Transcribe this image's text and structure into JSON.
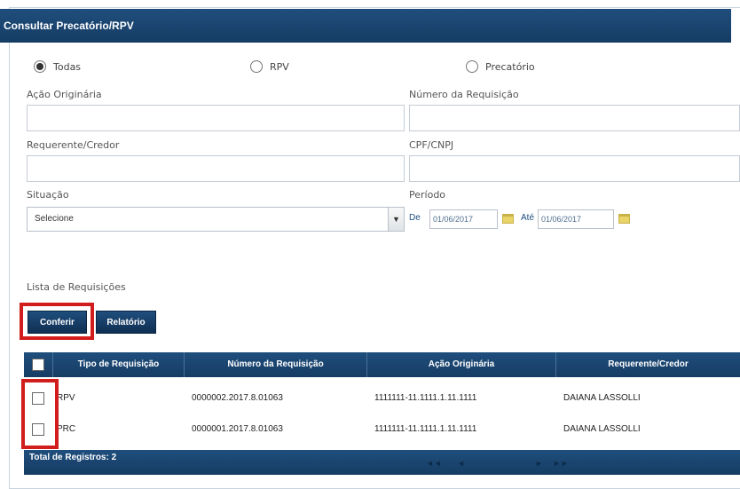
{
  "window": {
    "title": "Consultar Precatório/RPV"
  },
  "filters": {
    "radio_options": [
      {
        "label": "Todas",
        "checked": true
      },
      {
        "label": "RPV",
        "checked": false
      },
      {
        "label": "Precatório",
        "checked": false
      }
    ],
    "acao_originaria_label": "Ação Originária",
    "numero_requisicao_label": "Número da Requisição",
    "requerente_label": "Requerente/Credor",
    "cpf_cnpj_label": "CPF/CNPJ",
    "situacao_label": "Situação",
    "situacao_value": "Selecione",
    "periodo_label": "Período",
    "de_label": "De",
    "de_value": "01/06/2017",
    "ate_label": "Até",
    "ate_value": "01/06/2017"
  },
  "list": {
    "title": "Lista de Requisições",
    "conferir_label": "Conferir",
    "relatorio_label": "Relatório",
    "columns": [
      "Tipo de Requisição",
      "Número da Requisição",
      "Ação Originária",
      "Requerente/Credor"
    ],
    "rows": [
      {
        "tipo": "RPV",
        "numero": "0000002.2017.8.01063",
        "acao": "1111111-11.1111.1.11.1111",
        "requerente": "DAIANA LASSOLLI"
      },
      {
        "tipo": "PRC",
        "numero": "0000001.2017.8.01063",
        "acao": "1111111-11.1111.1.11.1111",
        "requerente": "DAIANA LASSOLLI"
      }
    ],
    "total_label": "Total de Registros: 2",
    "pager": {
      "first": "◄◄",
      "prev": "◄",
      "next": "►",
      "last": "►►"
    }
  },
  "colors": {
    "header": "#1f4e7d",
    "highlight": "#d21d1d"
  }
}
